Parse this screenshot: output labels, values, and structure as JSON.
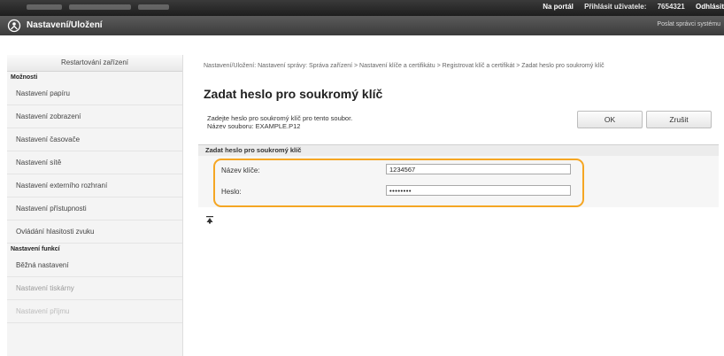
{
  "topbar": {
    "portal": "Na portál",
    "login_label": "Přihlásit uživatele:",
    "user_id": "7654321",
    "logout": "Odhlásit"
  },
  "header": {
    "title": "Nastavení/Uložení",
    "send_admin": "Poslat správci systému"
  },
  "sidebar": {
    "restart": "Restartování zařízení",
    "section_options": "Možnosti",
    "items": [
      "Nastavení papíru",
      "Nastavení zobrazení",
      "Nastavení časovače",
      "Nastavení sítě",
      "Nastavení externího rozhraní",
      "Nastavení přístupnosti",
      "Ovládání hlasitosti zvuku"
    ],
    "section_functions": "Nastavení funkcí",
    "function_items": [
      "Běžná nastavení",
      "Nastavení tiskárny",
      "Nastavení příjmu"
    ]
  },
  "main": {
    "breadcrumb": "Nastavení/Uložení: Nastavení správy: Správa zařízení > Nastavení klíče a certifikátu > Registrovat klíč a certifikát > Zadat heslo pro soukromý klíč",
    "title": "Zadat heslo pro soukromý klíč",
    "description": "Zadejte heslo pro soukromý klíč pro tento soubor.",
    "filename_line": "Název souboru: EXAMPLE.P12",
    "ok_label": "OK",
    "cancel_label": "Zrušit",
    "panel_title": "Zadat heslo pro soukromý klíč",
    "key_label": "Název klíče:",
    "key_value": "1234567",
    "pw_label": "Heslo:",
    "pw_value": "••••••••"
  },
  "colors": {
    "highlight": "#f5a623",
    "topbar": "#2a2a2a",
    "header": "#4a4a4a"
  }
}
